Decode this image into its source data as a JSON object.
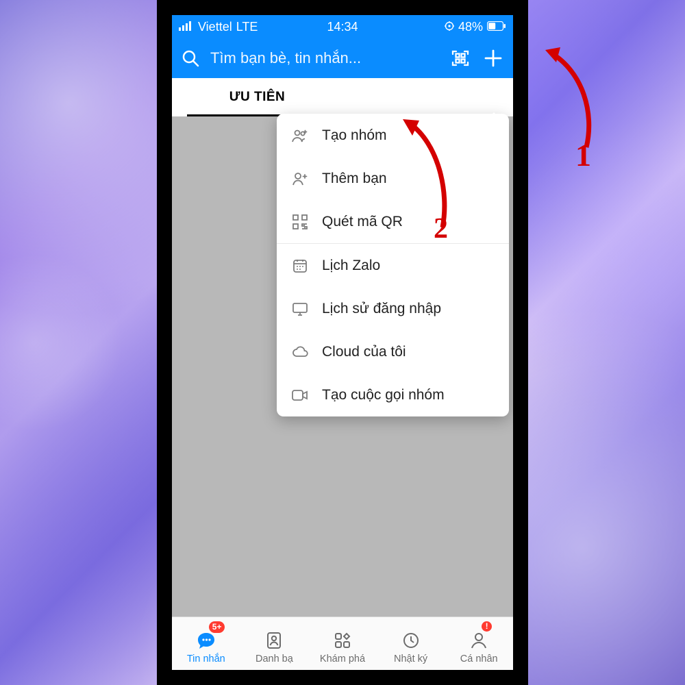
{
  "statusbar": {
    "carrier": "Viettel",
    "network": "LTE",
    "time": "14:34",
    "battery": "48%"
  },
  "header": {
    "search_placeholder": "Tìm bạn bè, tin nhắn..."
  },
  "tabs": {
    "priority": "ƯU TIÊN"
  },
  "popup": {
    "create_group": "Tạo nhóm",
    "add_friend": "Thêm bạn",
    "scan_qr": "Quét mã QR",
    "calendar": "Lịch Zalo",
    "login_history": "Lịch sử đăng nhập",
    "my_cloud": "Cloud của tôi",
    "group_call": "Tạo cuộc gọi nhóm"
  },
  "bottomnav": {
    "messages": "Tin nhắn",
    "messages_badge": "5+",
    "contacts": "Danh bạ",
    "discover": "Khám phá",
    "diary": "Nhật ký",
    "profile": "Cá nhân",
    "profile_badge": "!"
  },
  "annotations": {
    "one": "1",
    "two": "2"
  }
}
